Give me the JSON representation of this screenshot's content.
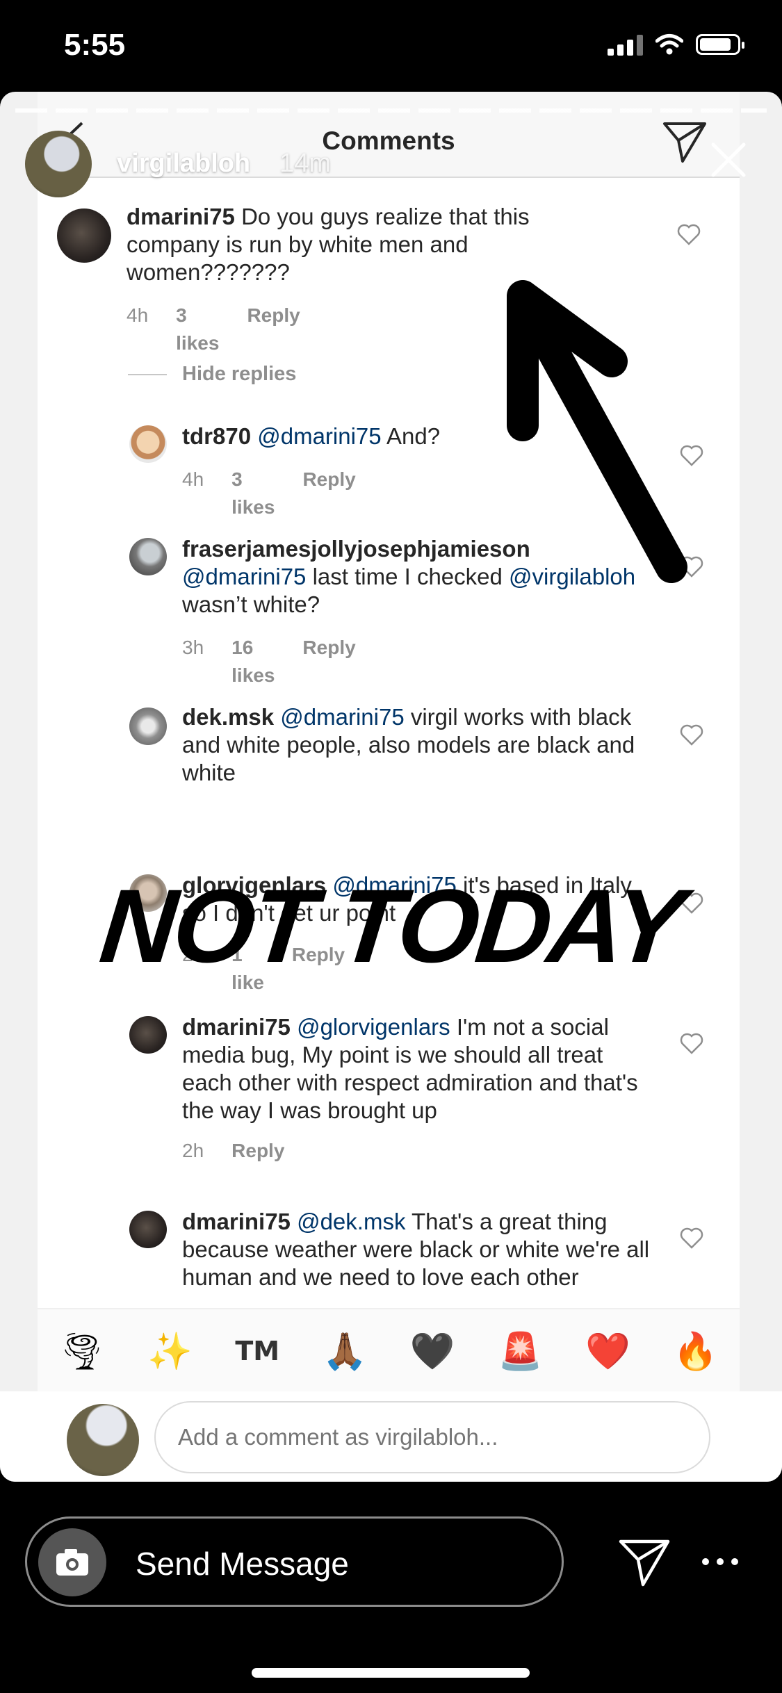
{
  "status": {
    "time": "5:55"
  },
  "story": {
    "username": "virgilabloh",
    "time": "14m"
  },
  "comments_header": {
    "title": "Comments"
  },
  "comments": [
    {
      "user": "dmarini75",
      "text": " Do you guys realize that this company is run by white men and women???????",
      "age": "4h",
      "likes": "3 likes",
      "reply": "Reply"
    },
    {
      "user": "tdr870",
      "mention": "@dmarini75",
      "text": " And?",
      "age": "4h",
      "likes": "3 likes",
      "reply": "Reply"
    },
    {
      "user": "fraserjamesjollyjosephjamieson",
      "mention": "@dmarini75",
      "text": " last time I checked ",
      "mention2": "@virgilabloh",
      "text2": " wasn’t white?",
      "age": "3h",
      "likes": "16 likes",
      "reply": "Reply"
    },
    {
      "user": "dek.msk",
      "mention": "@dmarini75",
      "text": " virgil works with black and white people, also models are black and white"
    },
    {
      "user": "glorvigenlars",
      "mention": "@dmarini75",
      "text": " it's based in Italy so I don't get ur point",
      "age": "2h",
      "likes": "1 like",
      "reply": "Reply"
    },
    {
      "user": "dmarini75",
      "mention": "@glorvigenlars",
      "text": "  I'm not a social media bug, My point is we should all treat each other with respect admiration and that's the way I was brought up",
      "age": "2h",
      "reply": "Reply"
    },
    {
      "user": "dmarini75",
      "mention": "@dek.msk",
      "text": "  That's a great thing because weather were black or white we're all human and we need to love each other"
    }
  ],
  "hide_replies": "Hide replies",
  "emoji_bar": [
    "🌪",
    "✨",
    "TM",
    "🙏🏾",
    "🖤",
    "🚨",
    "❤️",
    "🔥"
  ],
  "add_comment": {
    "placeholder": "Add a comment as virgilabloh..."
  },
  "overlay": {
    "text": "NOT TODAY"
  },
  "bottom": {
    "send_message": "Send Message"
  }
}
